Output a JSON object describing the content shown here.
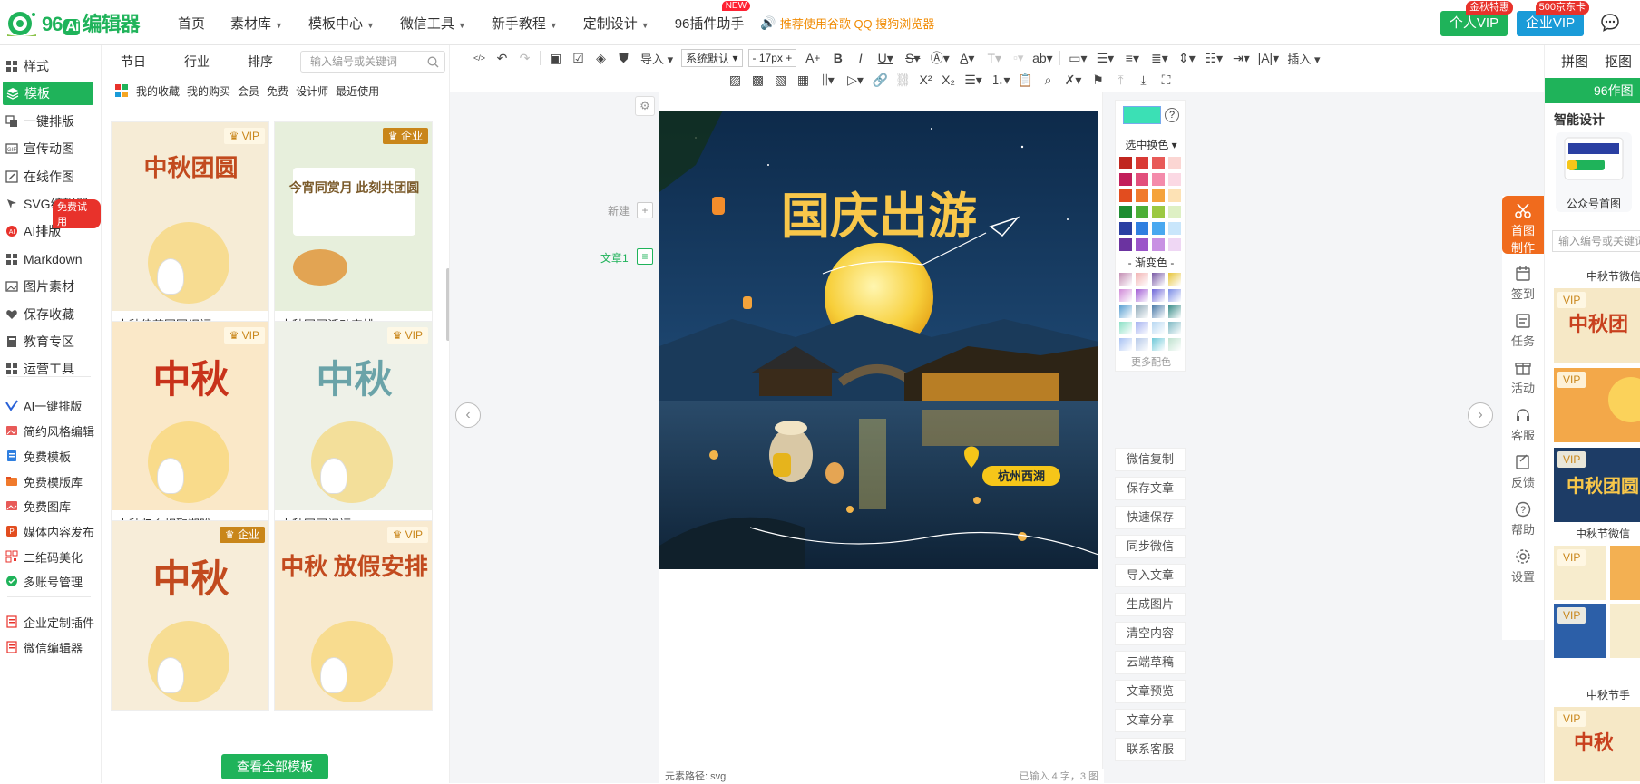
{
  "brand": {
    "logo_text": "96",
    "logo_ai": "Ai",
    "logo_suffix": "编辑器"
  },
  "nav": [
    {
      "label": "首页",
      "caret": false
    },
    {
      "label": "素材库",
      "caret": true
    },
    {
      "label": "模板中心",
      "caret": true
    },
    {
      "label": "微信工具",
      "caret": true
    },
    {
      "label": "新手教程",
      "caret": true
    },
    {
      "label": "定制设计",
      "caret": true
    },
    {
      "label": "96插件助手",
      "caret": false,
      "badge": "NEW"
    }
  ],
  "recommend": "推荐使用谷歌 QQ 搜狗浏览器",
  "vip": {
    "personal": {
      "label": "个人VIP",
      "tag": "金秋特惠"
    },
    "enterprise": {
      "label": "企业VIP",
      "tag": "500京东卡"
    }
  },
  "sidebar": {
    "items": [
      {
        "label": "样式",
        "icon": "grid-icon"
      },
      {
        "label": "模板",
        "icon": "layers-icon",
        "active": true
      },
      {
        "label": "一键排版",
        "icon": "copy-icon"
      },
      {
        "label": "宣传动图",
        "icon": "gif-icon"
      },
      {
        "label": "在线作图",
        "icon": "edit-icon"
      },
      {
        "label": "SVG编辑器",
        "icon": "cursor-icon"
      },
      {
        "label": "AI排版",
        "icon": "ai-icon"
      },
      {
        "label": "Markdown",
        "icon": "grid-icon"
      },
      {
        "label": "图片素材",
        "icon": "image-icon"
      },
      {
        "label": "保存收藏",
        "icon": "heart-icon"
      },
      {
        "label": "教育专区",
        "icon": "book-icon"
      },
      {
        "label": "运营工具",
        "icon": "grid-icon"
      }
    ],
    "free_trial": "免费试用",
    "extras": [
      {
        "label": "AI一键排版",
        "icon": "ai-wand-icon"
      },
      {
        "label": "简约风格编辑",
        "icon": "image-red-icon"
      },
      {
        "label": "免费模板",
        "icon": "doc-blue-icon"
      },
      {
        "label": "免费模版库",
        "icon": "folder-icon"
      },
      {
        "label": "免费图库",
        "icon": "image-red-icon"
      },
      {
        "label": "媒体内容发布",
        "icon": "ppt-icon"
      },
      {
        "label": "二维码美化",
        "icon": "qr-icon"
      },
      {
        "label": "多账号管理",
        "icon": "check-green-icon"
      }
    ],
    "bottom": [
      {
        "label": "企业定制插件",
        "icon": "plugin-icon"
      },
      {
        "label": "微信编辑器",
        "icon": "plugin-icon"
      }
    ]
  },
  "templates": {
    "tabs": [
      "节日",
      "行业",
      "排序"
    ],
    "search_placeholder": "输入编号或关键词",
    "filters": [
      "我的收藏",
      "我的购买",
      "会员",
      "免费",
      "设计师",
      "最近使用"
    ],
    "cards": [
      {
        "caption": "中秋佳节团圆祝福",
        "badge": "VIP",
        "bg": "#f6ecd6",
        "title": "中秋团圆",
        "theme": "rabbit"
      },
      {
        "caption": "中秋团圆活动安排",
        "badge": "企业",
        "bg": "#e7efdc",
        "title": "今宵同赏月 此刻共团圆",
        "theme": "card"
      },
      {
        "caption": "中秋归乡相聚期盼",
        "badge": "VIP",
        "bg": "#fae8c8",
        "title": "中秋",
        "theme": "red"
      },
      {
        "caption": "中秋团圆祝福",
        "badge": "VIP",
        "bg": "#eef1e8",
        "title": "中秋",
        "theme": "green"
      },
      {
        "caption": "",
        "badge": "企业",
        "bg": "#f7edd9",
        "title": "中秋",
        "theme": "warm"
      },
      {
        "caption": "",
        "badge": "VIP",
        "bg": "#f8ead0",
        "title": "中秋 放假安排",
        "theme": "holiday"
      }
    ],
    "view_all": "查看全部模板"
  },
  "toolbar": {
    "import": "导入",
    "font_family": "系统默认",
    "font_size": "17px",
    "insert": "插入"
  },
  "editor": {
    "new_label": "新建",
    "article_label": "文章1",
    "poster_title": "国庆出游",
    "poster_location": "杭州西湖",
    "status_path": "元素路径: svg",
    "status_count": "已输入 4 字，3 图"
  },
  "colors": {
    "current": "#3be0b5",
    "swap_label": "选中换色",
    "gradient_label": "- 渐变色 -",
    "more_label": "更多配色",
    "swatches": [
      "#c0261f",
      "#d93a35",
      "#e85a58",
      "#fbd6d3",
      "#c21f5b",
      "#e24f7c",
      "#f48bab",
      "#fbd9e4",
      "#e24d1f",
      "#f07a2c",
      "#f5a33b",
      "#fde2b5",
      "#1e8d32",
      "#4caf37",
      "#9cc942",
      "#def0c4",
      "#2a3fa2",
      "#2f7fe0",
      "#49a8f0",
      "#c9e6fb",
      "#6b33a0",
      "#9a55c9",
      "#c891e3",
      "#efd7f4"
    ],
    "gradients": [
      "#c48fb4",
      "#f2b3b3",
      "#7a5ba6",
      "#e7c53b",
      "#d08ad8",
      "#a15bd4",
      "#6e66d8",
      "#7c8ee6",
      "#5aa0d2",
      "#8fa9b8",
      "#4b7aa8",
      "#3b8e8a",
      "#8be0c6",
      "#a5b2f0",
      "#b8d8f2",
      "#7fb9c4",
      "#a8c2f3",
      "#b5c9e8",
      "#6fc9d8",
      "#bfe2cf"
    ]
  },
  "actions": [
    "微信复制",
    "保存文章",
    "快速保存",
    "同步微信",
    "导入文章",
    "生成图片",
    "清空内容",
    "云端草稿",
    "文章预览",
    "文章分享",
    "联系客服"
  ],
  "right_tools": [
    {
      "label": "首图制作",
      "icon": "scissors-icon",
      "highlight": true
    },
    {
      "label": "签到",
      "icon": "calendar-icon"
    },
    {
      "label": "任务",
      "icon": "task-icon"
    },
    {
      "label": "活动",
      "icon": "gift-icon"
    },
    {
      "label": "客服",
      "icon": "headset-icon"
    },
    {
      "label": "反馈",
      "icon": "feedback-icon"
    },
    {
      "label": "帮助",
      "icon": "help-icon"
    },
    {
      "label": "设置",
      "icon": "settings-icon"
    }
  ],
  "right_panel": {
    "tabs": [
      "拼图",
      "抠图"
    ],
    "bar": "96作图",
    "smart_title": "智能设计",
    "card_caption": "公众号首图",
    "search_placeholder": "输入编号或关键词",
    "section1": "中秋节微信",
    "section2": "中秋节微信",
    "section3": "中秋节手"
  }
}
